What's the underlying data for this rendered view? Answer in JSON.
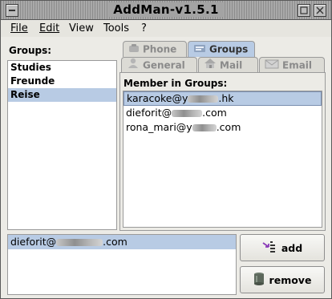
{
  "window": {
    "title": "AddMan-v1.5.1"
  },
  "menubar": {
    "items": [
      {
        "label": "File"
      },
      {
        "label": "Edit"
      },
      {
        "label": "View"
      },
      {
        "label": "Tools"
      },
      {
        "label": "?"
      }
    ]
  },
  "groups": {
    "label": "Groups:",
    "items": [
      {
        "label": "Studies",
        "selected": false
      },
      {
        "label": "Freunde",
        "selected": false
      },
      {
        "label": "Reise",
        "selected": true
      }
    ]
  },
  "tabs": {
    "row1": [
      {
        "label": "Phone",
        "icon": "phone-icon",
        "active": false
      },
      {
        "label": "Groups",
        "icon": "groups-icon",
        "active": true
      }
    ],
    "row2": [
      {
        "label": "General",
        "icon": "person-icon",
        "active": false
      },
      {
        "label": "Mail",
        "icon": "house-icon",
        "active": false
      },
      {
        "label": "Email",
        "icon": "envelope-icon",
        "active": false
      }
    ]
  },
  "members": {
    "label": "Member in Groups:",
    "items": [
      {
        "prefix": "karacoke@y",
        "suffix": ".hk",
        "selected": true
      },
      {
        "prefix": "dieforit@",
        "suffix": ".com",
        "selected": false
      },
      {
        "prefix": "rona_mari@y",
        "suffix": ".com",
        "selected": false
      }
    ]
  },
  "selection": {
    "prefix": "dieforit@",
    "suffix": ".com"
  },
  "buttons": {
    "add_label": "add",
    "remove_label": "remove"
  },
  "colors": {
    "selection": "#b8cbe4",
    "window_bg": "#ecebe6"
  }
}
